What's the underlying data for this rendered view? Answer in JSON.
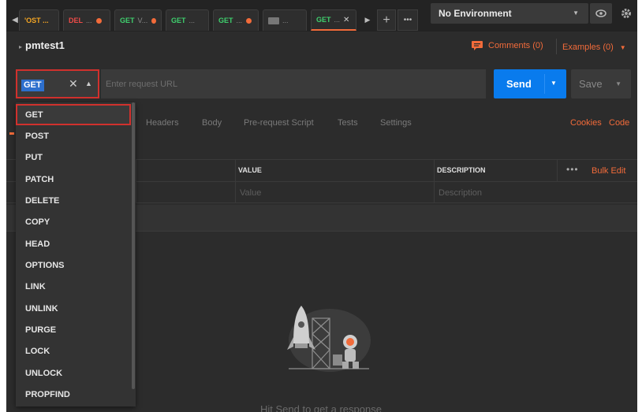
{
  "tabs": [
    {
      "method": "POST",
      "label": "...",
      "dirty": true,
      "kind": "post",
      "display": "'OST ..."
    },
    {
      "method": "DEL",
      "label": "...",
      "dirty": true,
      "kind": "del"
    },
    {
      "method": "GET",
      "label": "V...",
      "dirty": true,
      "kind": "get"
    },
    {
      "method": "GET",
      "label": "...",
      "dirty": false,
      "kind": "get"
    },
    {
      "method": "GET",
      "label": "...",
      "dirty": true,
      "kind": "get"
    },
    {
      "method": "",
      "label": "...",
      "dirty": false,
      "kind": "ws"
    },
    {
      "method": "GET",
      "label": "...",
      "dirty": false,
      "kind": "get",
      "active": true
    }
  ],
  "tab_first_display": "'OST ...",
  "tab_close_glyph": "✕",
  "environment": {
    "selected": "No Environment"
  },
  "request": {
    "name": "pmtest1",
    "method": "GET",
    "url_placeholder": "Enter request URL"
  },
  "comments_label": "Comments (0)",
  "examples_label": "Examples (0)",
  "send_label": "Send",
  "save_label": "Save",
  "request_tabs": [
    "Headers",
    "Body",
    "Pre-request Script",
    "Tests",
    "Settings"
  ],
  "cookies_label": "Cookies",
  "code_label": "Code",
  "params_table": {
    "headers": {
      "value": "VALUE",
      "description": "DESCRIPTION"
    },
    "placeholders": {
      "value": "Value",
      "description": "Description"
    },
    "bulk_edit": "Bulk Edit"
  },
  "method_options": [
    "GET",
    "POST",
    "PUT",
    "PATCH",
    "DELETE",
    "COPY",
    "HEAD",
    "OPTIONS",
    "LINK",
    "UNLINK",
    "PURGE",
    "LOCK",
    "UNLOCK",
    "PROPFIND"
  ],
  "response_hint": "Hit Send to get a response",
  "colors": {
    "accent": "#f26b3a",
    "send": "#097bed",
    "get": "#3fcf6d",
    "del": "#ed4b48",
    "post": "#f5a623",
    "highlight": "#d0312d"
  }
}
